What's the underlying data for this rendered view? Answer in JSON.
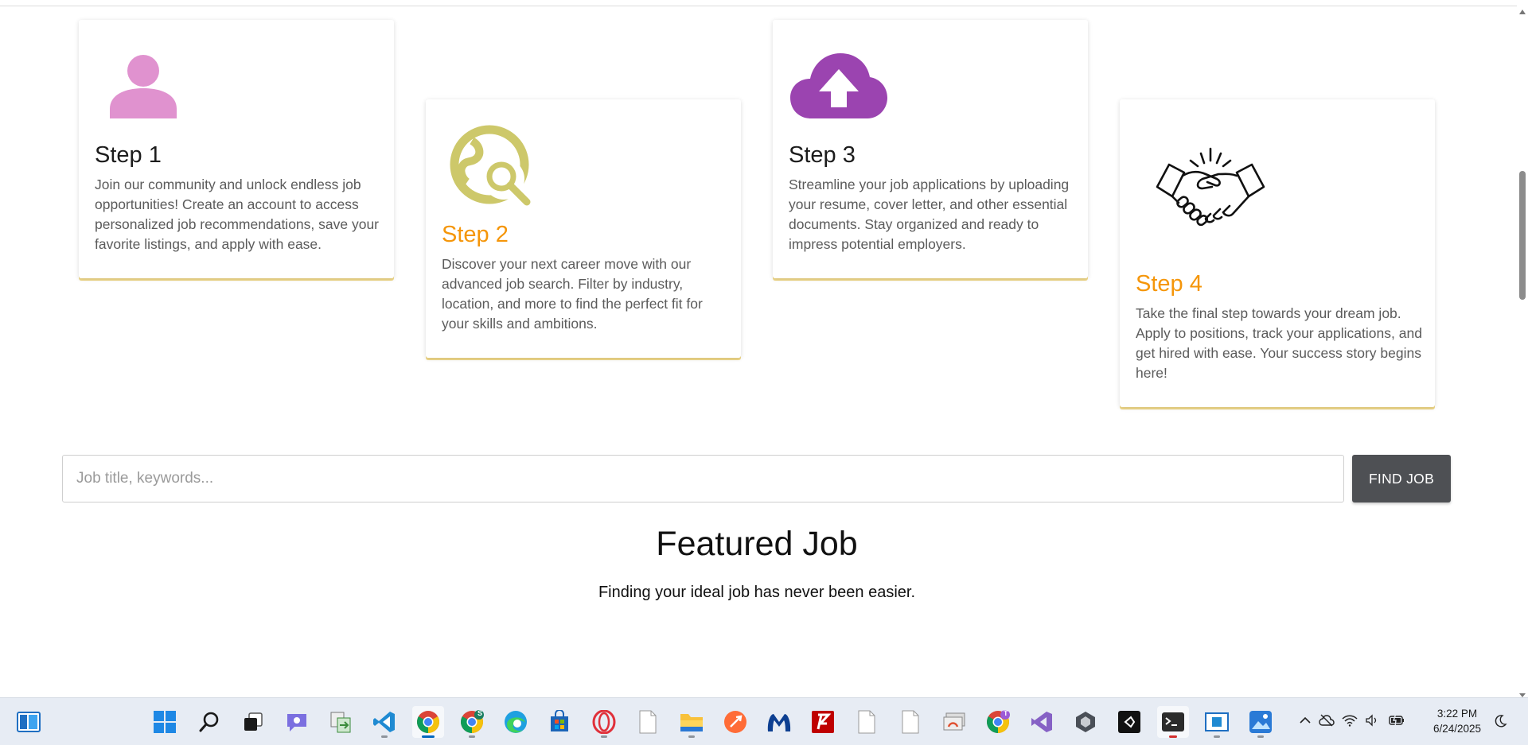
{
  "steps": [
    {
      "title": "Step 1",
      "text": "Join our community and unlock endless job opportunities! Create an account to access personalized job recommendations, save your favorite listings, and apply with ease.",
      "icon": "user-icon",
      "icon_color": "#e092cf"
    },
    {
      "title": "Step 2",
      "text": "Discover your next career move with our advanced job search. Filter by industry, location, and more to find the perfect fit for your skills and ambitions.",
      "icon": "globe-search-icon",
      "icon_color": "#cdc86a"
    },
    {
      "title": "Step 3",
      "text": "Streamline your job applications by uploading your resume, cover letter, and other essential documents. Stay organized and ready to impress potential employers.",
      "icon": "cloud-upload-icon",
      "icon_color": "#9b44b0"
    },
    {
      "title": "Step 4",
      "text": "Take the final step towards your dream job. Apply to positions, track your applications, and get hired with ease. Your success story begins here!",
      "icon": "handshake-icon",
      "icon_color": "#111111"
    }
  ],
  "colors": {
    "step_title_accent": "#f5960a",
    "card_underline": "#f1d98a",
    "button_bg": "#4e5054"
  },
  "search": {
    "placeholder": "Job title, keywords...",
    "value": "",
    "button_label": "FIND JOB"
  },
  "featured": {
    "title": "Featured Job",
    "subtitle": "Finding your ideal job has never been easier."
  },
  "taskbar": {
    "apps": [
      "widgets-icon",
      "start-icon",
      "search-icon",
      "task-view-icon",
      "chat-icon",
      "file-transfer-icon",
      "vscode-icon",
      "chrome-icon",
      "chrome-profile-icon",
      "edge-icon",
      "store-icon",
      "opera-icon",
      "file-icon",
      "file-explorer-icon",
      "postman-icon",
      "malwarebytes-icon",
      "filezilla-icon",
      "file-icon",
      "file-icon",
      "remote-desktop-icon",
      "chrome-alt-icon",
      "visual-studio-icon",
      "unity-icon",
      "unity-hub-icon",
      "terminal-icon",
      "sandbox-icon",
      "photos-icon"
    ],
    "chrome_profile_badge": "S",
    "chrome_alt_badge": "T",
    "time": "3:22 PM",
    "date": "6/24/2025"
  }
}
